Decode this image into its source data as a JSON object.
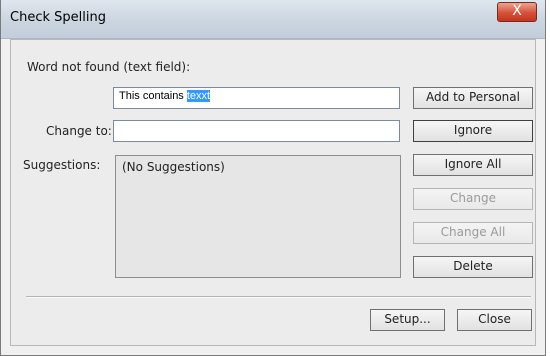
{
  "window": {
    "title": "Check Spelling",
    "close_glyph": "X"
  },
  "form": {
    "word_not_found_label": "Word not found (text field):",
    "word_not_found_plain": "This contains ",
    "word_not_found_highlight": "texxt",
    "change_to_label": "Change to:",
    "change_to_value": "",
    "suggestions_label": "Suggestions:",
    "suggestions": [
      "(No Suggestions)"
    ]
  },
  "buttons": {
    "add_to_personal": "Add to Personal",
    "ignore": "Ignore",
    "ignore_all": "Ignore All",
    "change": "Change",
    "change_all": "Change All",
    "delete": "Delete",
    "setup": "Setup...",
    "close": "Close"
  },
  "colors": {
    "selection": "#3399ff",
    "close_button": "#d6513a"
  },
  "icons": {
    "close": "close-icon"
  }
}
